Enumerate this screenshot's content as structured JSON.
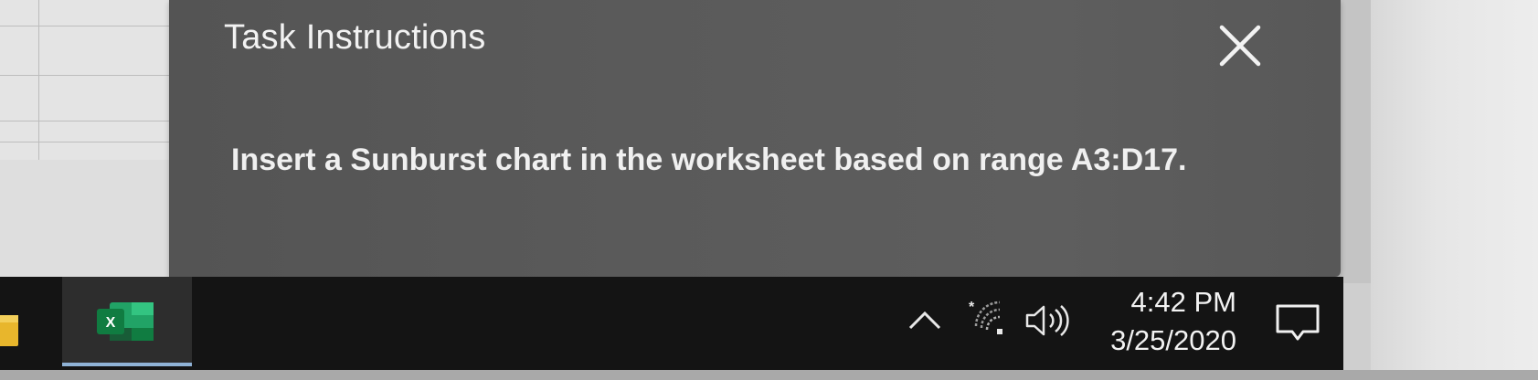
{
  "dialog": {
    "title": "Task Instructions",
    "close_icon": "close-icon",
    "instruction": "Insert a Sunburst chart in the worksheet based on range A3:D17."
  },
  "taskbar": {
    "apps": [
      {
        "name": "file-explorer",
        "icon": "folder-icon"
      },
      {
        "name": "excel",
        "icon": "excel-icon",
        "active": true
      }
    ],
    "tray": {
      "chevron_icon": "chevron-up-icon",
      "network_icon": "wifi-icon",
      "volume_icon": "volume-icon"
    },
    "clock": {
      "time": "4:42 PM",
      "date": "3/25/2020"
    },
    "notifications_icon": "notification-icon"
  },
  "colors": {
    "dialog_bg": "#575757",
    "taskbar_bg": "#141414",
    "excel_green": "#1e7145",
    "active_underline": "#8fb2d6"
  }
}
